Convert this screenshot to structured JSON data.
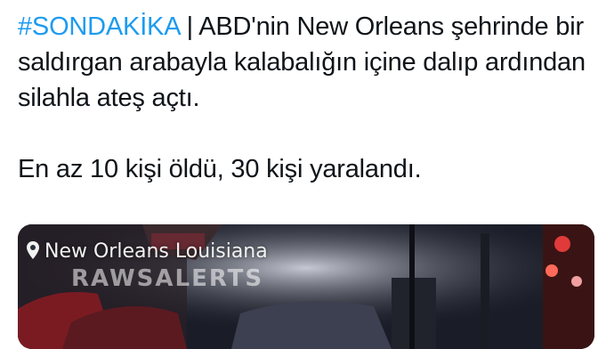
{
  "tweet": {
    "hashtag": "#SONDAKİKA",
    "separator": " | ",
    "text_1": "ABD'nin New Orleans şehrinde bir saldırgan arabayla kalabalığın içine dalıp ardından silahla ateş açtı.",
    "text_2": "En az 10 kişi öldü, 30 kişi yaralandı."
  },
  "media": {
    "location_label": "New Orleans Louisiana",
    "watermark": "RAWSALERTS",
    "icon": "location-pin-icon"
  },
  "colors": {
    "hashtag": "#1d9bf0",
    "text": "#0f1419",
    "background": "#ffffff"
  }
}
